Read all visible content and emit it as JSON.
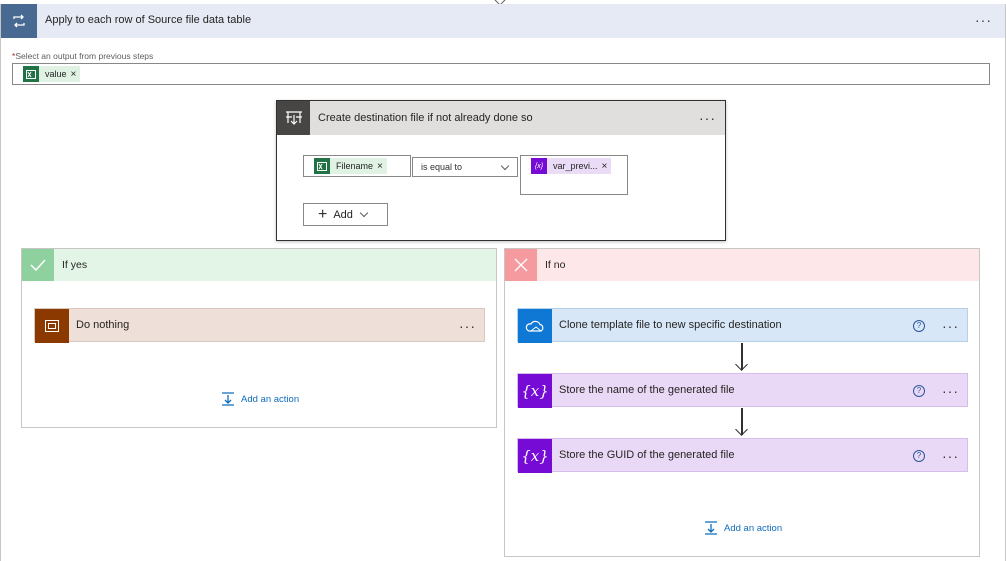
{
  "loop": {
    "title": "Apply to each row of Source file data table",
    "more": "···",
    "field_required_mark": "*",
    "field_label": "Select an output from previous steps",
    "token_label": "value",
    "token_remove": "×",
    "colors": {
      "header_bg": "#e5eaf4",
      "icon_bg": "#486991"
    }
  },
  "condition": {
    "title": "Create destination file if not already done so",
    "more": "···",
    "left_token": "Filename",
    "left_remove": "×",
    "operator": "is equal to",
    "right_token": "var_previ...",
    "right_remove": "×",
    "add_label": "Add",
    "right_token_icon_text": "{x}"
  },
  "if_yes": {
    "title": "If yes",
    "color": "#e3f5e7",
    "icon_color": "#8ed09e",
    "actions": [
      {
        "title": "Do nothing",
        "more": "···",
        "icon": "scope-icon",
        "icon_color": "#8c3900",
        "bg": "#eee0d8"
      }
    ],
    "add_action": "Add an action"
  },
  "if_no": {
    "title": "If no",
    "color": "#fde7e9",
    "icon_color": "#f59a9f",
    "actions": [
      {
        "title": "Clone template file to new specific destination",
        "more": "···",
        "help": "?",
        "icon": "onedrive-icon",
        "icon_color": "#0f78d4",
        "bg": "#d7e7f7"
      },
      {
        "title": "Store the name of the generated file",
        "more": "···",
        "help": "?",
        "icon": "variable-icon",
        "icon_text": "{x}",
        "icon_color": "#770bd6",
        "bg": "#ead9f6"
      },
      {
        "title": "Store the GUID of the generated file",
        "more": "···",
        "help": "?",
        "icon": "variable-icon",
        "icon_text": "{x}",
        "icon_color": "#770bd6",
        "bg": "#ead9f6"
      }
    ],
    "add_action": "Add an action"
  }
}
